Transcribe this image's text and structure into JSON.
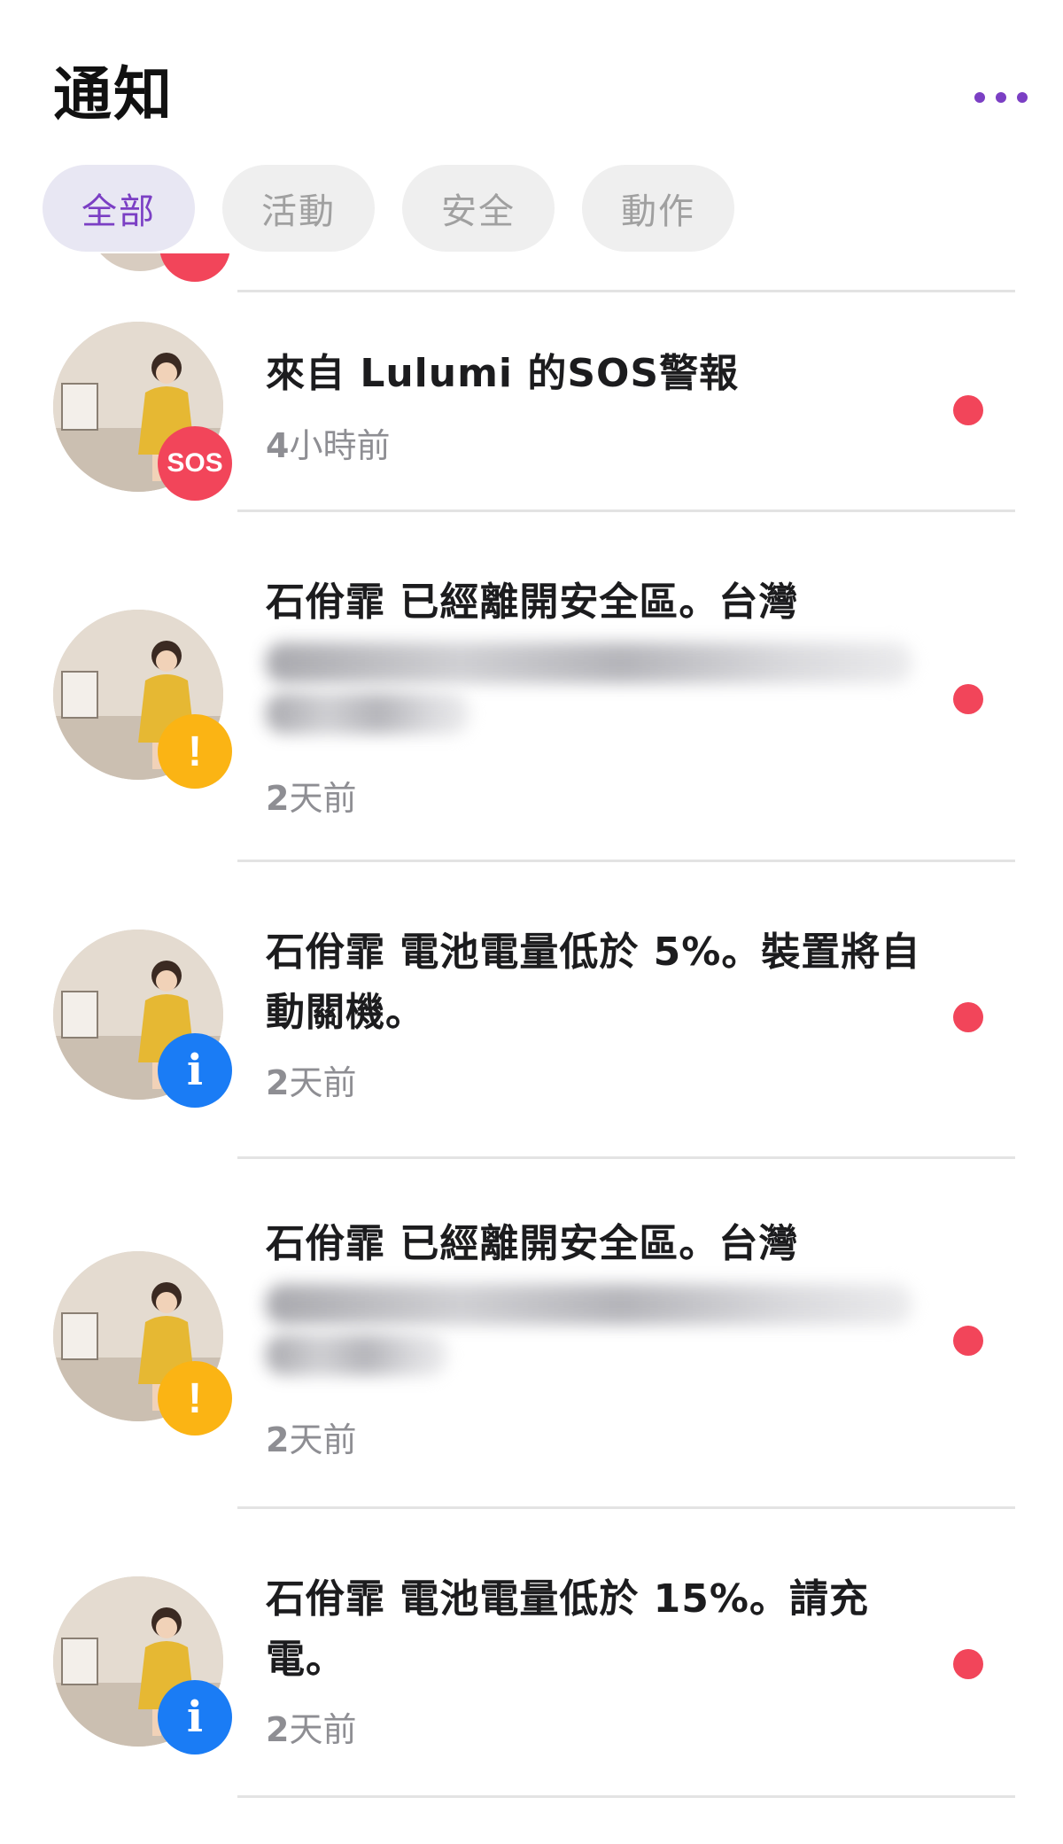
{
  "header": {
    "title": "通知",
    "more_icon": "more-horizontal-icon",
    "accent_color": "#7b3fc4"
  },
  "tabs": [
    {
      "label": "全部",
      "active": true
    },
    {
      "label": "活動",
      "active": false
    },
    {
      "label": "安全",
      "active": false
    },
    {
      "label": "動作",
      "active": false
    }
  ],
  "notifications": [
    {
      "title": "來自 Lulumi 的SOS警報",
      "time_num": "4",
      "time_unit": "小時前",
      "badge": "SOS",
      "badge_type": "sos",
      "unread": true
    },
    {
      "title": "石佾霏 已經離開安全區。台灣",
      "blurred": true,
      "time_num": "2",
      "time_unit": "天前",
      "badge": "!",
      "badge_type": "warn",
      "unread": true
    },
    {
      "title": "石佾霏 電池電量低於 5%。裝置將自動關機。",
      "time_num": "2",
      "time_unit": "天前",
      "badge": "i",
      "badge_type": "info",
      "unread": true
    },
    {
      "title": "石佾霏 已經離開安全區。台灣",
      "blurred": true,
      "time_num": "2",
      "time_unit": "天前",
      "badge": "!",
      "badge_type": "warn",
      "unread": true
    },
    {
      "title": "石佾霏 電池電量低於 15%。請充電。",
      "time_num": "2",
      "time_unit": "天前",
      "badge": "i",
      "badge_type": "info",
      "unread": true
    }
  ],
  "colors": {
    "unread_dot": "#f2455a",
    "sos_badge": "#f2455a",
    "warning_badge": "#fbb414",
    "info_badge": "#1a7cf5"
  }
}
